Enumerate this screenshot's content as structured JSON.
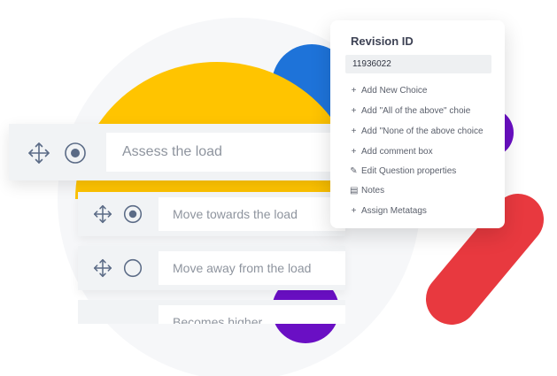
{
  "colors": {
    "yellow": "#FFC400",
    "blue": "#1E73D9",
    "purple": "#6A0FC4",
    "red": "#E8393F",
    "card": "#F1F3F5"
  },
  "question": {
    "main_label": "Assess the load",
    "choices": [
      {
        "label": "Move towards the load",
        "selected": true
      },
      {
        "label": "Move away from the load",
        "selected": false
      },
      {
        "label": "Becomes higher",
        "selected": false
      }
    ]
  },
  "menu": {
    "title": "Revision ID",
    "revision_value": "11936022",
    "items": [
      {
        "icon": "plus-icon",
        "glyph": "+",
        "label": "Add New Choice"
      },
      {
        "icon": "plus-icon",
        "glyph": "+",
        "label": "Add \"All of the above\" choie"
      },
      {
        "icon": "plus-icon",
        "glyph": "+",
        "label": "Add \"None of the above choice"
      },
      {
        "icon": "plus-icon",
        "glyph": "+",
        "label": "Add comment box"
      },
      {
        "icon": "pencil-icon",
        "glyph": "✎",
        "label": "Edit Question properties"
      },
      {
        "icon": "notes-icon",
        "glyph": "▤",
        "label": "Notes"
      },
      {
        "icon": "plus-icon",
        "glyph": "+",
        "label": "Assign Metatags"
      }
    ]
  }
}
